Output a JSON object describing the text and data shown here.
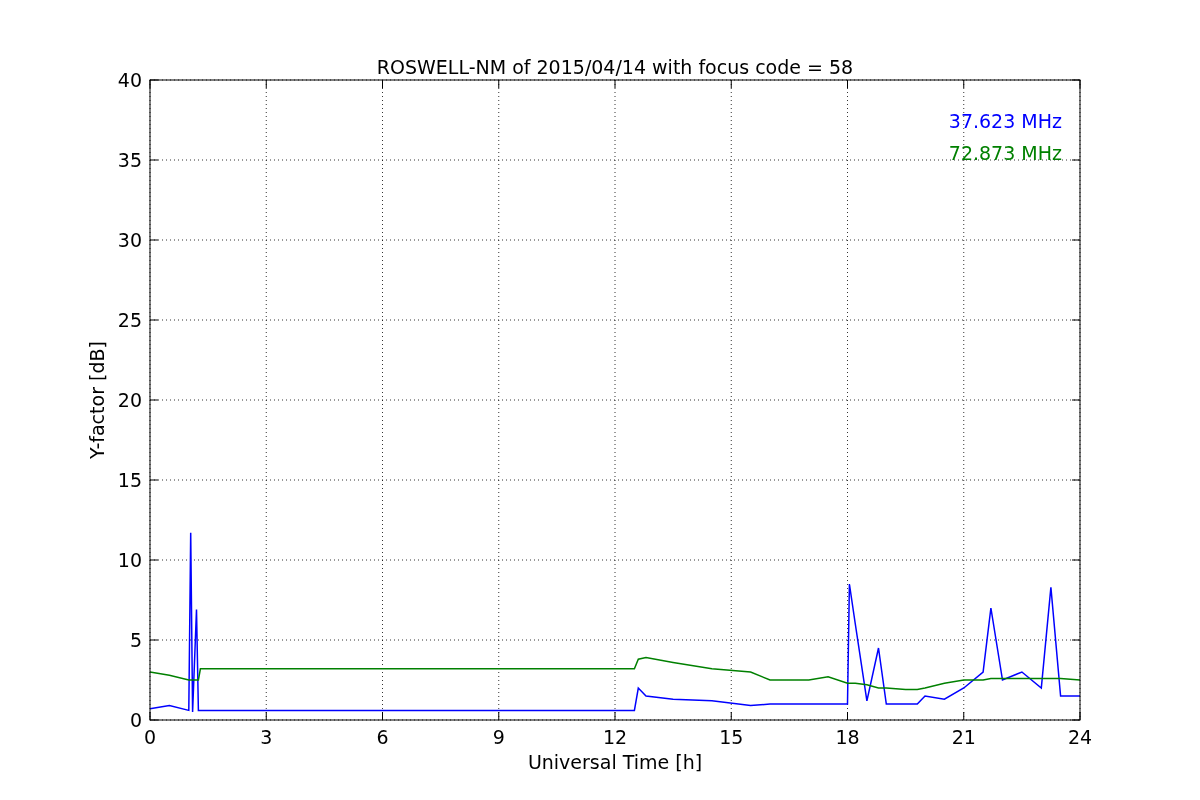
{
  "chart_data": {
    "type": "line",
    "title": "ROSWELL-NM of 2015/04/14 with focus code = 58",
    "xlabel": "Universal Time [h]",
    "ylabel": "Y-factor [dB]",
    "x": [
      0,
      0.5,
      1.0,
      1.05,
      1.1,
      1.2,
      1.25,
      1.3,
      12.5,
      12.6,
      12.8,
      13.5,
      14.5,
      15.5,
      16,
      17,
      17.5,
      18,
      18.05,
      18.2,
      18.5,
      18.8,
      19,
      19.5,
      19.8,
      20,
      20.5,
      21,
      21.5,
      21.7,
      22,
      22.5,
      23,
      23.25,
      23.5,
      24
    ],
    "series": [
      {
        "name": "37.623 MHz",
        "color": "#0000ff",
        "values": [
          0.7,
          0.9,
          0.6,
          11.7,
          0.5,
          6.9,
          0.6,
          0.6,
          0.6,
          2,
          1.5,
          1.3,
          1.2,
          0.9,
          1,
          1,
          1,
          1,
          8.5,
          6,
          1.2,
          4.5,
          1,
          1,
          1,
          1.5,
          1.3,
          2,
          3,
          7,
          2.5,
          3,
          2,
          8.3,
          1.5,
          1.5
        ]
      },
      {
        "name": "72.873 MHz",
        "color": "#008000",
        "values": [
          3,
          2.8,
          2.5,
          2.5,
          2.5,
          2.5,
          2.5,
          3.2,
          3.2,
          3.8,
          3.9,
          3.6,
          3.2,
          3,
          2.5,
          2.5,
          2.7,
          2.3,
          2.3,
          2.3,
          2.2,
          2,
          2,
          1.9,
          1.9,
          2,
          2.3,
          2.5,
          2.5,
          2.6,
          2.6,
          2.6,
          2.6,
          2.6,
          2.6,
          2.5
        ]
      }
    ],
    "xlim": [
      0,
      24
    ],
    "ylim": [
      0,
      40
    ],
    "xticks": [
      0,
      3,
      6,
      9,
      12,
      15,
      18,
      21,
      24
    ],
    "yticks": [
      0,
      5,
      10,
      15,
      20,
      25,
      30,
      35,
      40
    ],
    "grid": true
  }
}
